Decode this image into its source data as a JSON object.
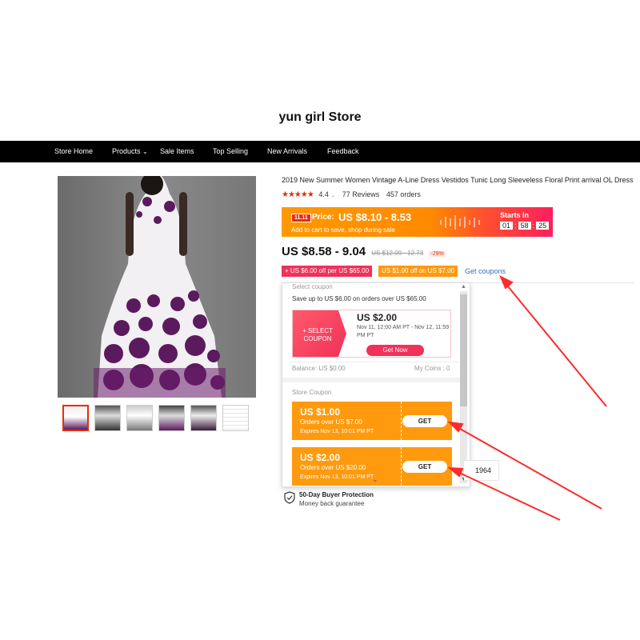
{
  "store": {
    "title": "yun girl Store"
  },
  "nav": [
    "Store Home",
    "Products",
    "Sale Items",
    "Top Selling",
    "New Arrivals",
    "Feedback"
  ],
  "product": {
    "title": "2019 New Summer Women Vintage A-Line Dress Vestidos Tunic Long Sleeveless Floral Print arrival OL Dress",
    "rating": "4.4",
    "stars": 4.5,
    "reviews": "77 Reviews",
    "orders": "457 orders",
    "price_range": "US $8.58 - 9.04",
    "old_price": "US $12.09 - 12.73",
    "discount": "-29%"
  },
  "promo": {
    "badge": "11.11",
    "price_label": "Price:",
    "price": "US $8.10 - 8.53",
    "note": "Add to cart to save, shop during sale",
    "starts_in": "Starts in",
    "timer_h": "01",
    "timer_m": "58",
    "timer_s": "25"
  },
  "coupon_tags": {
    "seller": "+ US $6.00 off per US $65.00",
    "store": "US $1.00 off on US $7.00",
    "get_coupons": "Get coupons"
  },
  "popup": {
    "select_coupon": "Select coupon",
    "save_line": "Save up to US $6.00 on orders over US $65.00",
    "seller_coupon": {
      "select_label": "+ SELECT COUPON",
      "amount": "US $2.00",
      "validity": "Nov 11, 12:00 AM PT - Nov 12, 11:59 PM PT",
      "cta": "Get Now"
    },
    "balance": "Balance: US $0.00",
    "my_coins": "My Coins : 0",
    "store_coupon_label": "Store Coupon",
    "store_coupons": [
      {
        "amount": "US $1.00",
        "condition": "Orders over US $7.00",
        "expires": "Expires Nov 13, 10:01 PM PT",
        "cta": "GET"
      },
      {
        "amount": "US $2.00",
        "condition": "Orders over US $20.00",
        "expires": "Expires Nov 13, 10:01 PM PT",
        "cta": "GET"
      }
    ]
  },
  "hidden_count": "1964",
  "protection": {
    "title": "50-Day Buyer Protection",
    "subtitle": "Money back guarantee"
  },
  "colors": {
    "nav_bg": "#000000",
    "accent_red": "#e62e04",
    "promo_orange": "#ff9900",
    "promo_pink": "#ff1f5e",
    "coupon_orange": "#ff9a0e",
    "link_blue": "#2f6fbf",
    "arrow_red": "#ff2a2a",
    "dress_purple": "#5b1a5e"
  }
}
